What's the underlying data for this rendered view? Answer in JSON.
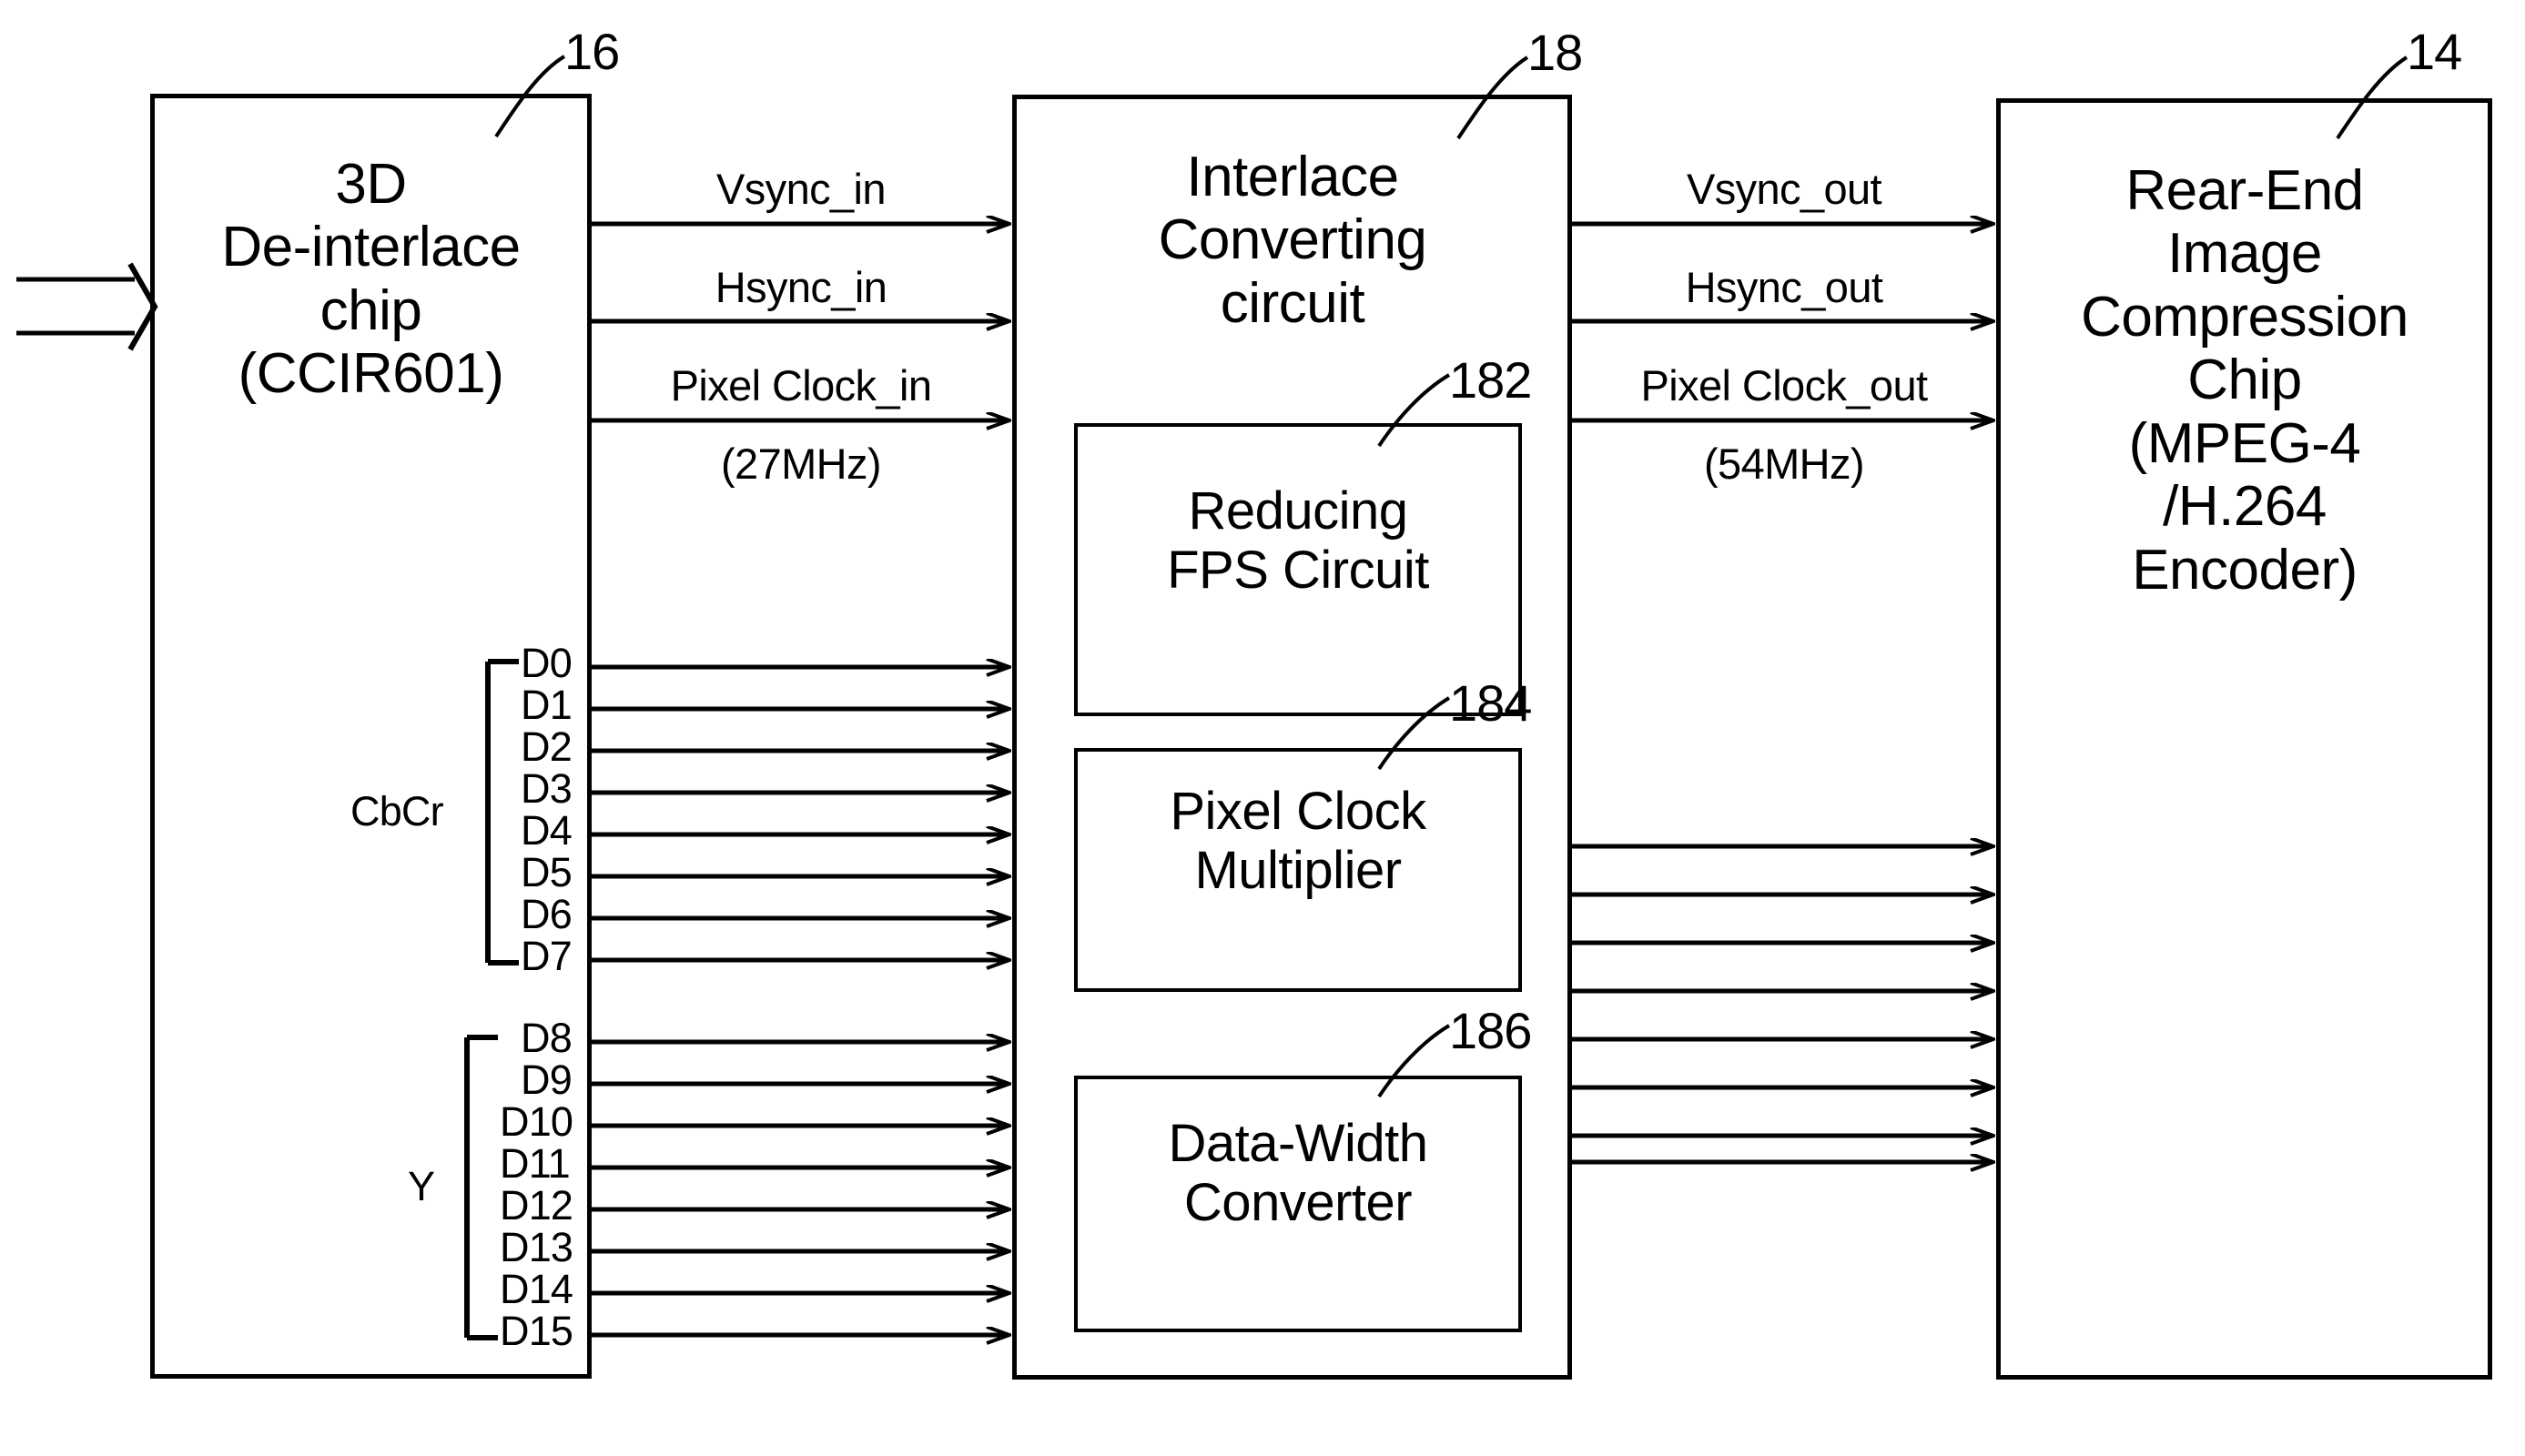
{
  "figure": {
    "type": "block-diagram",
    "description": "Video pipeline block diagram: 3D De-interlace chip feeds an Interlace Converting circuit which feeds a Rear-End Image Compression Chip."
  },
  "blocks": [
    {
      "id": "deinterlace",
      "ref": "16",
      "title_lines": [
        "3D",
        "De-interlace",
        "chip",
        "(CCIR601)"
      ]
    },
    {
      "id": "interlace_converting",
      "ref": "18",
      "title_lines": [
        "Interlace",
        "Converting",
        "circuit"
      ],
      "children": [
        {
          "id": "reducing_fps",
          "ref": "182",
          "title_lines": [
            "Reducing",
            "FPS Circuit"
          ]
        },
        {
          "id": "pixel_clock_multiplier",
          "ref": "184",
          "title_lines": [
            "Pixel Clock",
            "Multiplier"
          ]
        },
        {
          "id": "data_width_converter",
          "ref": "186",
          "title_lines": [
            "Data-Width",
            "Converter"
          ]
        }
      ]
    },
    {
      "id": "rear_end",
      "ref": "14",
      "title_lines": [
        "Rear-End",
        "Image",
        "Compression",
        "Chip",
        "(MPEG-4",
        "/H.264",
        "Encoder)"
      ]
    }
  ],
  "input_signals": [
    {
      "id": "vsync_in",
      "label": "Vsync_in",
      "sub": ""
    },
    {
      "id": "hsync_in",
      "label": "Hsync_in",
      "sub": ""
    },
    {
      "id": "pixel_clock_in",
      "label": "Pixel Clock_in",
      "sub": "(27MHz)"
    }
  ],
  "output_signals": [
    {
      "id": "vsync_out",
      "label": "Vsync_out",
      "sub": ""
    },
    {
      "id": "hsync_out",
      "label": "Hsync_out",
      "sub": ""
    },
    {
      "id": "pixel_clock_out",
      "label": "Pixel Clock_out",
      "sub": "(54MHz)"
    }
  ],
  "bus_groups": [
    {
      "id": "cbcr",
      "group_label": "CbCr",
      "bits": [
        "D0",
        "D1",
        "D2",
        "D3",
        "D4",
        "D5",
        "D6",
        "D7"
      ]
    },
    {
      "id": "y",
      "group_label": "Y",
      "bits": [
        "D8",
        "D9",
        "D10",
        "D11",
        "D12",
        "D13",
        "D14",
        "D15"
      ]
    }
  ],
  "output_bus": {
    "id": "output_data_bus",
    "line_count": 8
  },
  "colors": {
    "line": "#000000",
    "background": "#ffffff",
    "text": "#000000"
  }
}
